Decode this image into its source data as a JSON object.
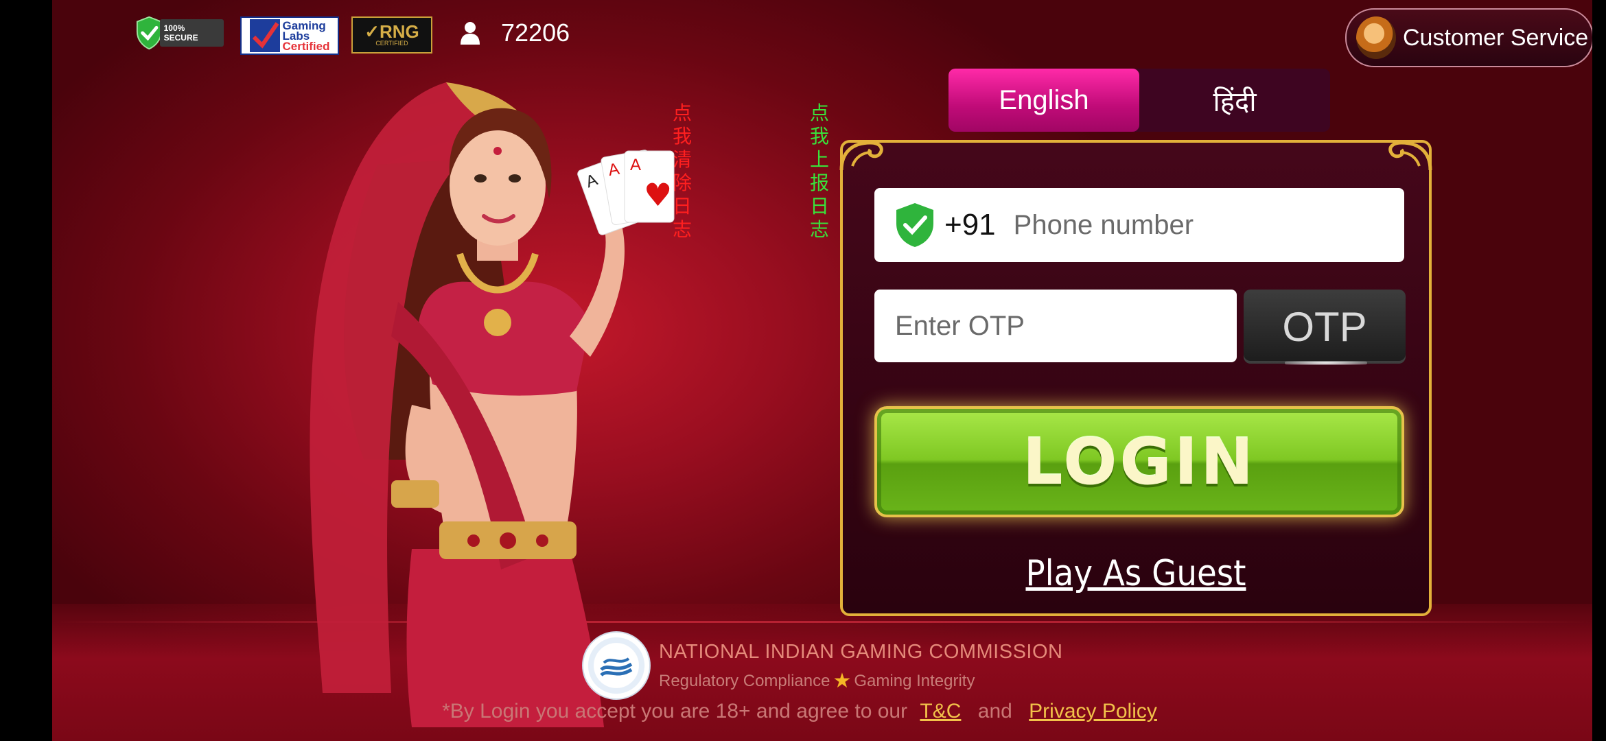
{
  "top_bar": {
    "badges": {
      "secure": "100% SECURE",
      "gaming_labs": [
        "Gaming",
        "Labs",
        "Certified"
      ],
      "rng": "RNG",
      "rng_sub": "CERTIFIED"
    },
    "online_count": "72206",
    "customer_service_label": "Customer Service"
  },
  "debug": {
    "clear_log": [
      "点我",
      "清除",
      "日志"
    ],
    "report_log": [
      "点我",
      "上报",
      "日志"
    ]
  },
  "language_tabs": [
    {
      "label": "English",
      "active": true
    },
    {
      "label": "हिंदी",
      "active": false
    }
  ],
  "login_form": {
    "country_code": "+91",
    "phone": {
      "value": "",
      "placeholder": "Phone number"
    },
    "otp": {
      "value": "",
      "placeholder": "Enter OTP"
    },
    "otp_button": "OTP",
    "login_button": "LOGIN",
    "guest_link": "Play As Guest"
  },
  "footer": {
    "commission_title": "NATIONAL INDIAN GAMING COMMISSION",
    "commission_sub_left": "Regulatory Compliance",
    "commission_sub_right": "Gaming Integrity",
    "terms_prefix": "*By Login you accept you are 18+ and agree to our",
    "terms_link": "T&C",
    "terms_and": "and",
    "privacy_link": "Privacy Policy"
  },
  "colors": {
    "accent_pink": "#c00b78",
    "panel_gold": "#e3b13a",
    "login_green": "#7fc823",
    "background_red": "#9a0e20"
  }
}
